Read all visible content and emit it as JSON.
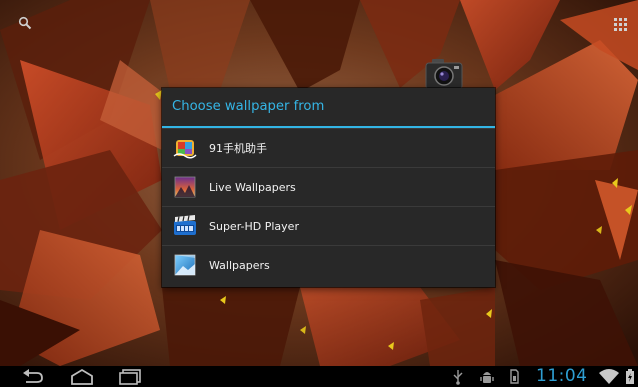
{
  "dialog": {
    "title": "Choose wallpaper from",
    "items": [
      {
        "label": "91手机助手",
        "icon": "91-assistant-icon"
      },
      {
        "label": "Live Wallpapers",
        "icon": "live-wallpapers-icon"
      },
      {
        "label": "Super-HD Player",
        "icon": "super-hd-player-icon"
      },
      {
        "label": "Wallpapers",
        "icon": "wallpapers-icon"
      }
    ]
  },
  "status_bar": {
    "time": "11:04"
  },
  "colors": {
    "accent": "#33b5e5",
    "dialog_bg": "#282828",
    "clock": "#2e9fd3"
  }
}
